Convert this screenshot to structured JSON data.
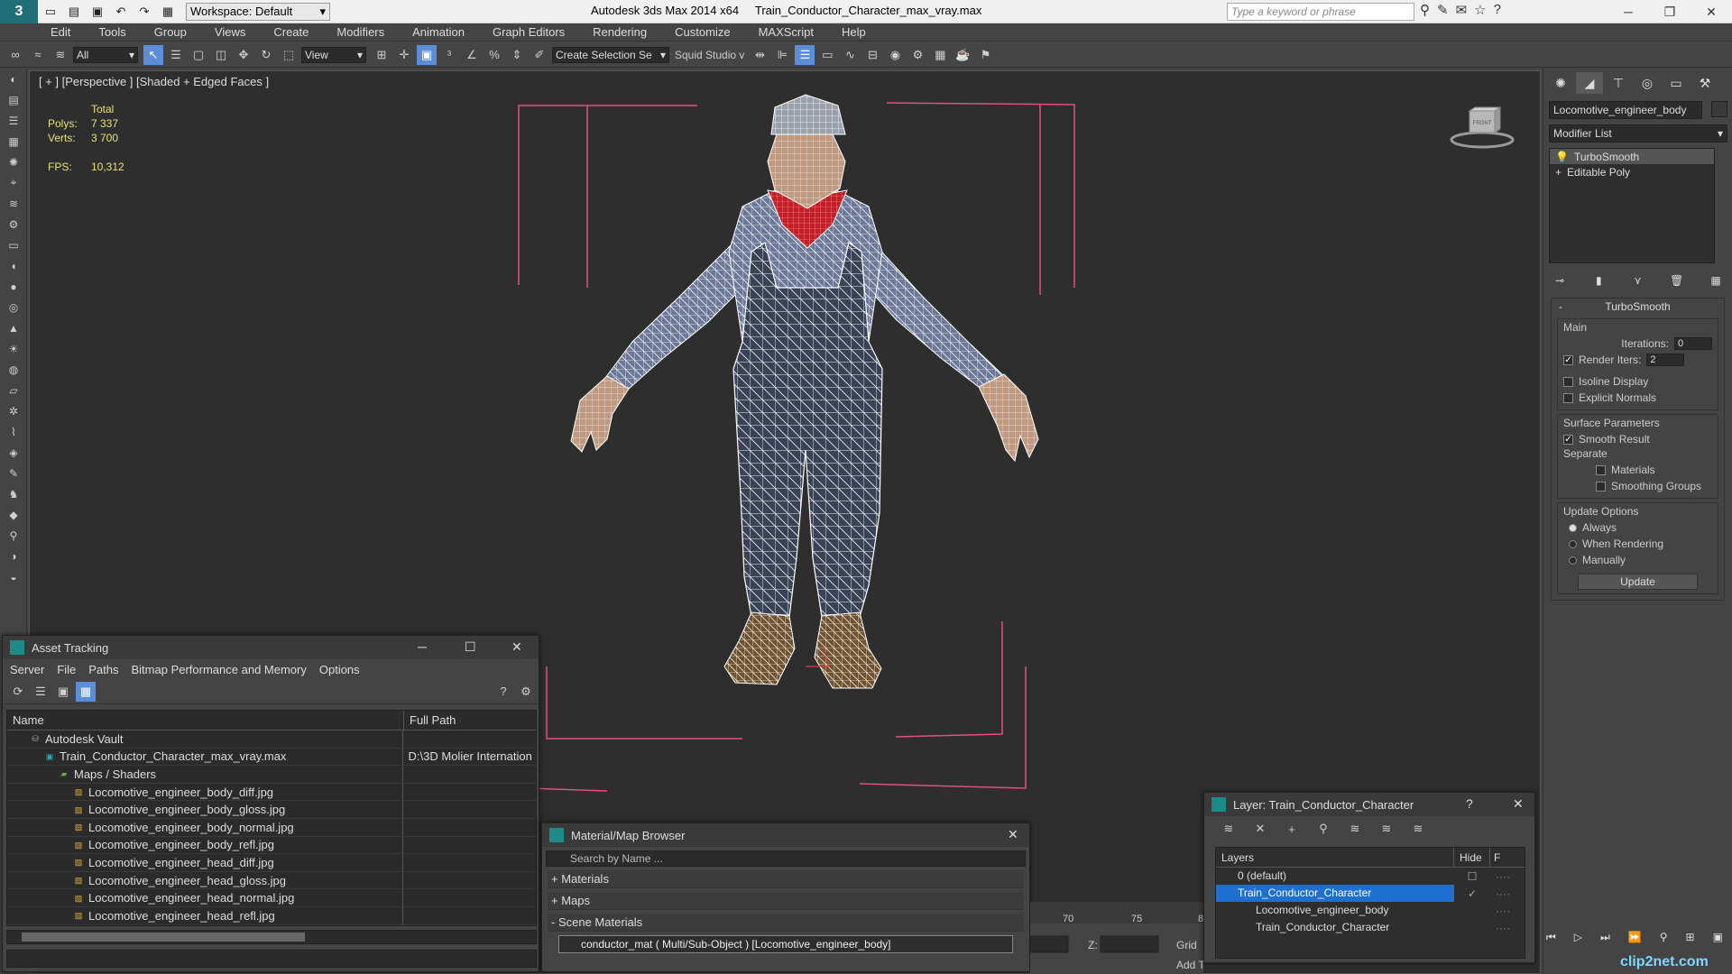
{
  "titlebar": {
    "workspace": "Workspace: Default",
    "app_title": "Autodesk 3ds Max  2014 x64",
    "file_title": "Train_Conductor_Character_max_vray.max",
    "search_placeholder": "Type a keyword or phrase"
  },
  "menu": [
    "Edit",
    "Tools",
    "Group",
    "Views",
    "Create",
    "Modifiers",
    "Animation",
    "Graph Editors",
    "Rendering",
    "Customize",
    "MAXScript",
    "Help"
  ],
  "toolbar": {
    "selection_filter": "All",
    "ref_coord": "View",
    "named_selection": "Create Selection Se",
    "studio_label": "Squid Studio v"
  },
  "viewport": {
    "label": "[ + ] [Perspective ] [Shaded + Edged Faces ]",
    "stats": {
      "header": "Total",
      "polys_label": "Polys:",
      "polys": "7 337",
      "verts_label": "Verts:",
      "verts": "3 700",
      "fps_label": "FPS:",
      "fps": "10,312"
    },
    "viewcube_label": "FRONT"
  },
  "command_panel": {
    "object_name": "Locomotive_engineer_body",
    "modifier_list": "Modifier List",
    "stack": [
      "TurboSmooth",
      "Editable Poly"
    ],
    "turbosmooth": {
      "title": "TurboSmooth",
      "main": "Main",
      "iterations_label": "Iterations:",
      "iterations": "0",
      "render_iters_label": "Render Iters:",
      "render_iters": "2",
      "isoline": "Isoline Display",
      "explicit": "Explicit Normals",
      "surface_params": "Surface Parameters",
      "smooth_result": "Smooth Result",
      "separate": "Separate",
      "materials": "Materials",
      "smoothing_groups": "Smoothing Groups",
      "update_options": "Update Options",
      "always": "Always",
      "when_rendering": "When Rendering",
      "manually": "Manually",
      "update_button": "Update"
    }
  },
  "asset_tracking": {
    "title": "Asset Tracking",
    "menu": [
      "Server",
      "File",
      "Paths",
      "Bitmap Performance and Memory",
      "Options"
    ],
    "col_name": "Name",
    "col_path": "Full Path",
    "rows": [
      {
        "name": "Autodesk Vault",
        "path": "",
        "indent": 0,
        "icon": "vault-icon"
      },
      {
        "name": "Train_Conductor_Character_max_vray.max",
        "path": "D:\\3D Molier Internation",
        "indent": 1,
        "icon": "max-file-icon"
      },
      {
        "name": "Maps / Shaders",
        "path": "",
        "indent": 2,
        "icon": "folder-icon"
      },
      {
        "name": "Locomotive_engineer_body_diff.jpg",
        "path": "",
        "indent": 3,
        "icon": "jpg-icon"
      },
      {
        "name": "Locomotive_engineer_body_gloss.jpg",
        "path": "",
        "indent": 3,
        "icon": "jpg-icon"
      },
      {
        "name": "Locomotive_engineer_body_normal.jpg",
        "path": "",
        "indent": 3,
        "icon": "jpg-icon"
      },
      {
        "name": "Locomotive_engineer_body_refl.jpg",
        "path": "",
        "indent": 3,
        "icon": "jpg-icon"
      },
      {
        "name": "Locomotive_engineer_head_diff.jpg",
        "path": "",
        "indent": 3,
        "icon": "jpg-icon"
      },
      {
        "name": "Locomotive_engineer_head_gloss.jpg",
        "path": "",
        "indent": 3,
        "icon": "jpg-icon"
      },
      {
        "name": "Locomotive_engineer_head_normal.jpg",
        "path": "",
        "indent": 3,
        "icon": "jpg-icon"
      },
      {
        "name": "Locomotive_engineer_head_refl.jpg",
        "path": "",
        "indent": 3,
        "icon": "jpg-icon"
      }
    ]
  },
  "material_browser": {
    "title": "Material/Map Browser",
    "search_placeholder": "Search by Name ...",
    "sections": [
      "+ Materials",
      "+ Maps",
      "- Scene Materials"
    ],
    "item": "conductor_mat  ( Multi/Sub-Object ) [Locomotive_engineer_body]"
  },
  "layer_panel": {
    "title": "Layer: Train_Conductor_Character",
    "col_layers": "Layers",
    "col_hide": "Hide",
    "col_f": "F",
    "rows": [
      {
        "name": "0 (default)",
        "selected": false
      },
      {
        "name": "Train_Conductor_Character",
        "selected": true
      },
      {
        "name": "Locomotive_engineer_body",
        "selected": false
      },
      {
        "name": "Train_Conductor_Character",
        "selected": false
      }
    ]
  },
  "timeline": {
    "ticks": [
      "70",
      "75",
      "8"
    ],
    "z_label": "Z:",
    "grid_label": "Grid",
    "add_label": "Add T"
  },
  "brand": "clip2net.com",
  "colors": {
    "viewport_bg": "#2e2e2e",
    "selection_blue": "#1e6fd0",
    "stats_yellow": "#e8e07a",
    "bbox_pink": "#e0507a"
  }
}
